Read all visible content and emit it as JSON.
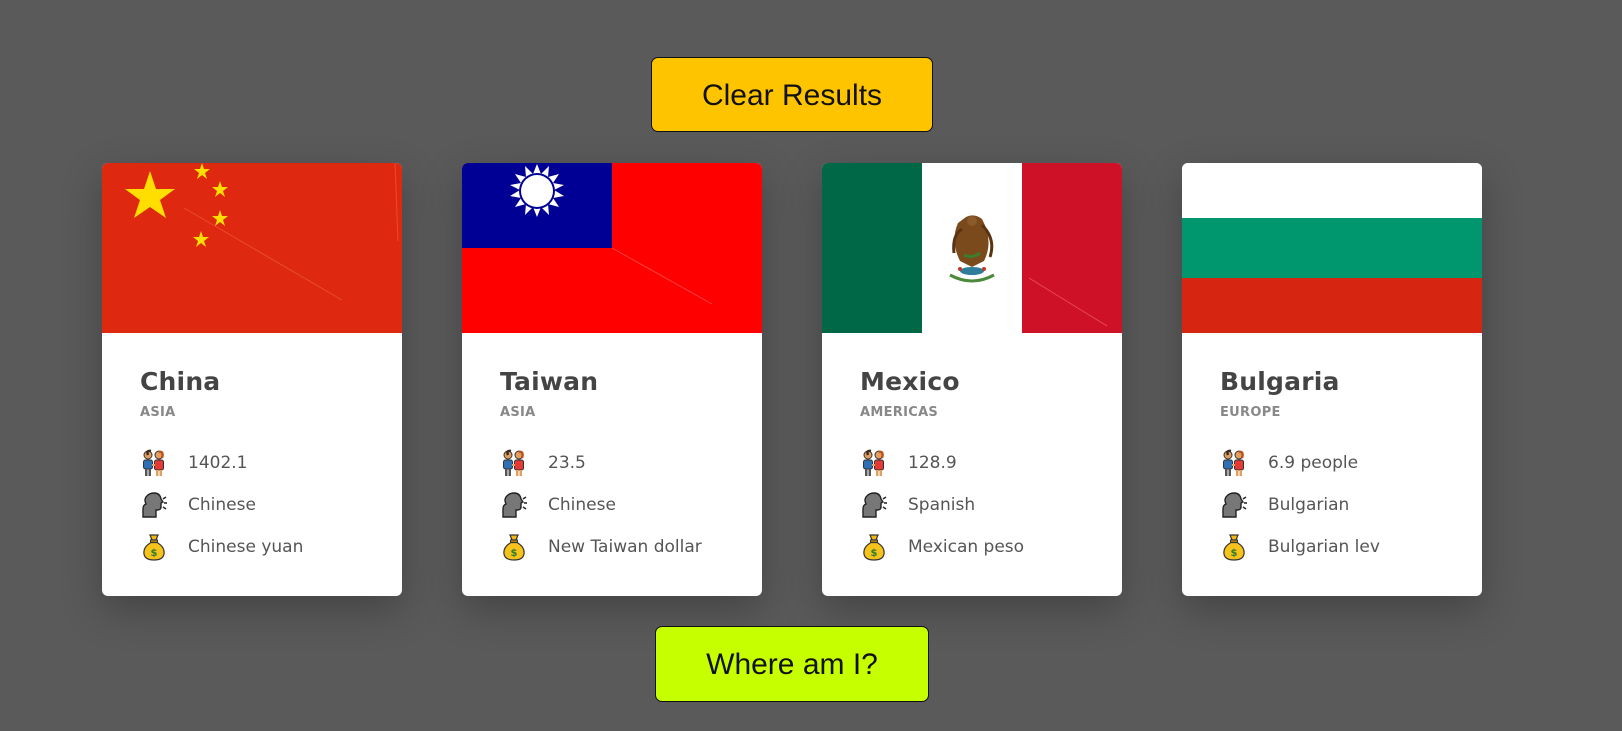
{
  "buttons": {
    "clear_label": "Clear Results",
    "clear_color": "#ffc400",
    "where_label": "Where am I?",
    "where_color": "#c6ff00"
  },
  "cards": [
    {
      "name": "China",
      "region": "ASIA",
      "flag": "china-flag",
      "population": "1402.1",
      "language": "Chinese",
      "currency": "Chinese yuan"
    },
    {
      "name": "Taiwan",
      "region": "ASIA",
      "flag": "taiwan-flag",
      "population": "23.5",
      "language": "Chinese",
      "currency": "New Taiwan dollar"
    },
    {
      "name": "Mexico",
      "region": "AMERICAS",
      "flag": "mexico-flag",
      "population": "128.9",
      "language": "Spanish",
      "currency": "Mexican peso"
    },
    {
      "name": "Bulgaria",
      "region": "EUROPE",
      "flag": "bulgaria-flag",
      "population": "6.9 people",
      "language": "Bulgarian",
      "currency": "Bulgarian lev"
    }
  ],
  "icons": {
    "population": "people-holding-hands-icon",
    "language": "speaking-head-icon",
    "currency": "money-bag-icon"
  },
  "colors": {
    "background": "#5a5a5a",
    "card_bg": "#ffffff",
    "china_red": "#de2910",
    "china_star": "#ffde00",
    "taiwan_red": "#fe0000",
    "taiwan_blue": "#000095",
    "mexico_green": "#006847",
    "mexico_red": "#ce1126",
    "bulgaria_green": "#00966e",
    "bulgaria_red": "#d62612"
  }
}
